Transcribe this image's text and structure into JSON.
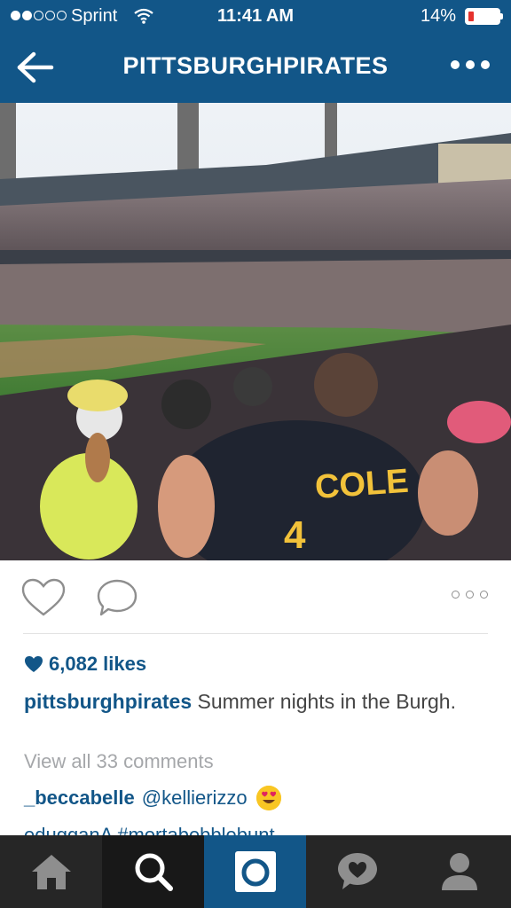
{
  "status_bar": {
    "carrier": "Sprint",
    "time": "11:41 AM",
    "battery_percent": "14%",
    "signal_bars": 2,
    "signal_total": 5
  },
  "nav": {
    "title": "PITTSBURGHPIRATES",
    "back_icon": "arrow-left-icon",
    "more_icon": "more-dots-icon"
  },
  "post": {
    "image_jersey_text": "COLE",
    "likes": "6,082 likes",
    "caption_user": "pittsburghpirates",
    "caption_text": "Summer nights in the Burgh.",
    "view_all": "View all 33 comments",
    "comments": [
      {
        "user": "_beccabelle",
        "text": "@kellierizzo"
      },
      {
        "user": "edugganA",
        "text": "#mortabebblebunt"
      }
    ]
  },
  "tabs": [
    {
      "name": "home",
      "icon": "home-icon"
    },
    {
      "name": "search",
      "icon": "search-icon"
    },
    {
      "name": "camera",
      "icon": "camera-icon"
    },
    {
      "name": "activity",
      "icon": "activity-heart-icon"
    },
    {
      "name": "profile",
      "icon": "profile-icon"
    }
  ],
  "colors": {
    "brand_blue": "#125688",
    "tabbar": "#262626",
    "battery_low": "#e5322d"
  }
}
